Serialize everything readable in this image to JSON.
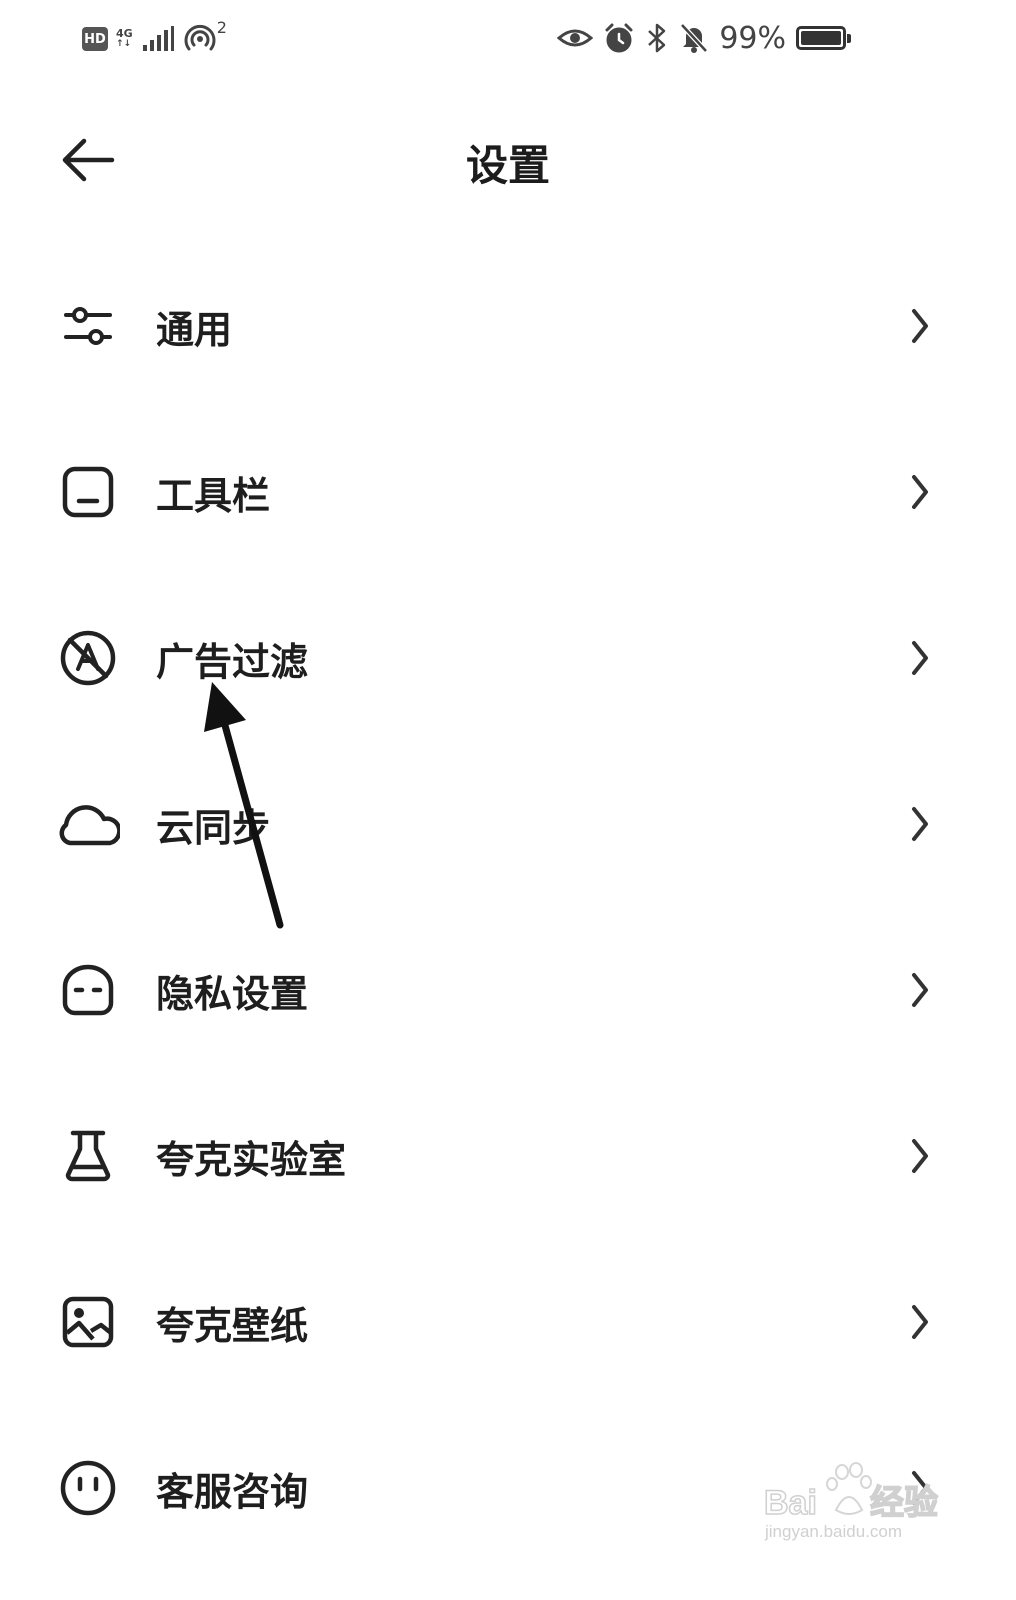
{
  "status_bar": {
    "hd_label": "HD",
    "network_label_top": "4G",
    "hotspot_count": "2",
    "battery_percent_text": "99%",
    "battery_level": 0.99
  },
  "header": {
    "title": "设置"
  },
  "settings": {
    "items": [
      {
        "label": "通用",
        "icon": "sliders-icon"
      },
      {
        "label": "工具栏",
        "icon": "toolbar-icon"
      },
      {
        "label": "广告过滤",
        "icon": "ad-block-icon"
      },
      {
        "label": "云同步",
        "icon": "cloud-icon"
      },
      {
        "label": "隐私设置",
        "icon": "privacy-face-icon"
      },
      {
        "label": "夸克实验室",
        "icon": "flask-icon"
      },
      {
        "label": "夸克壁纸",
        "icon": "image-icon"
      },
      {
        "label": "客服咨询",
        "icon": "smiley-icon"
      }
    ]
  },
  "watermark": {
    "brand": "Baidu经验",
    "url": "jingyan.baidu.com"
  },
  "colors": {
    "background": "#ffffff",
    "text": "#1e1e1e",
    "icon": "#222222",
    "chevron": "#333333"
  }
}
